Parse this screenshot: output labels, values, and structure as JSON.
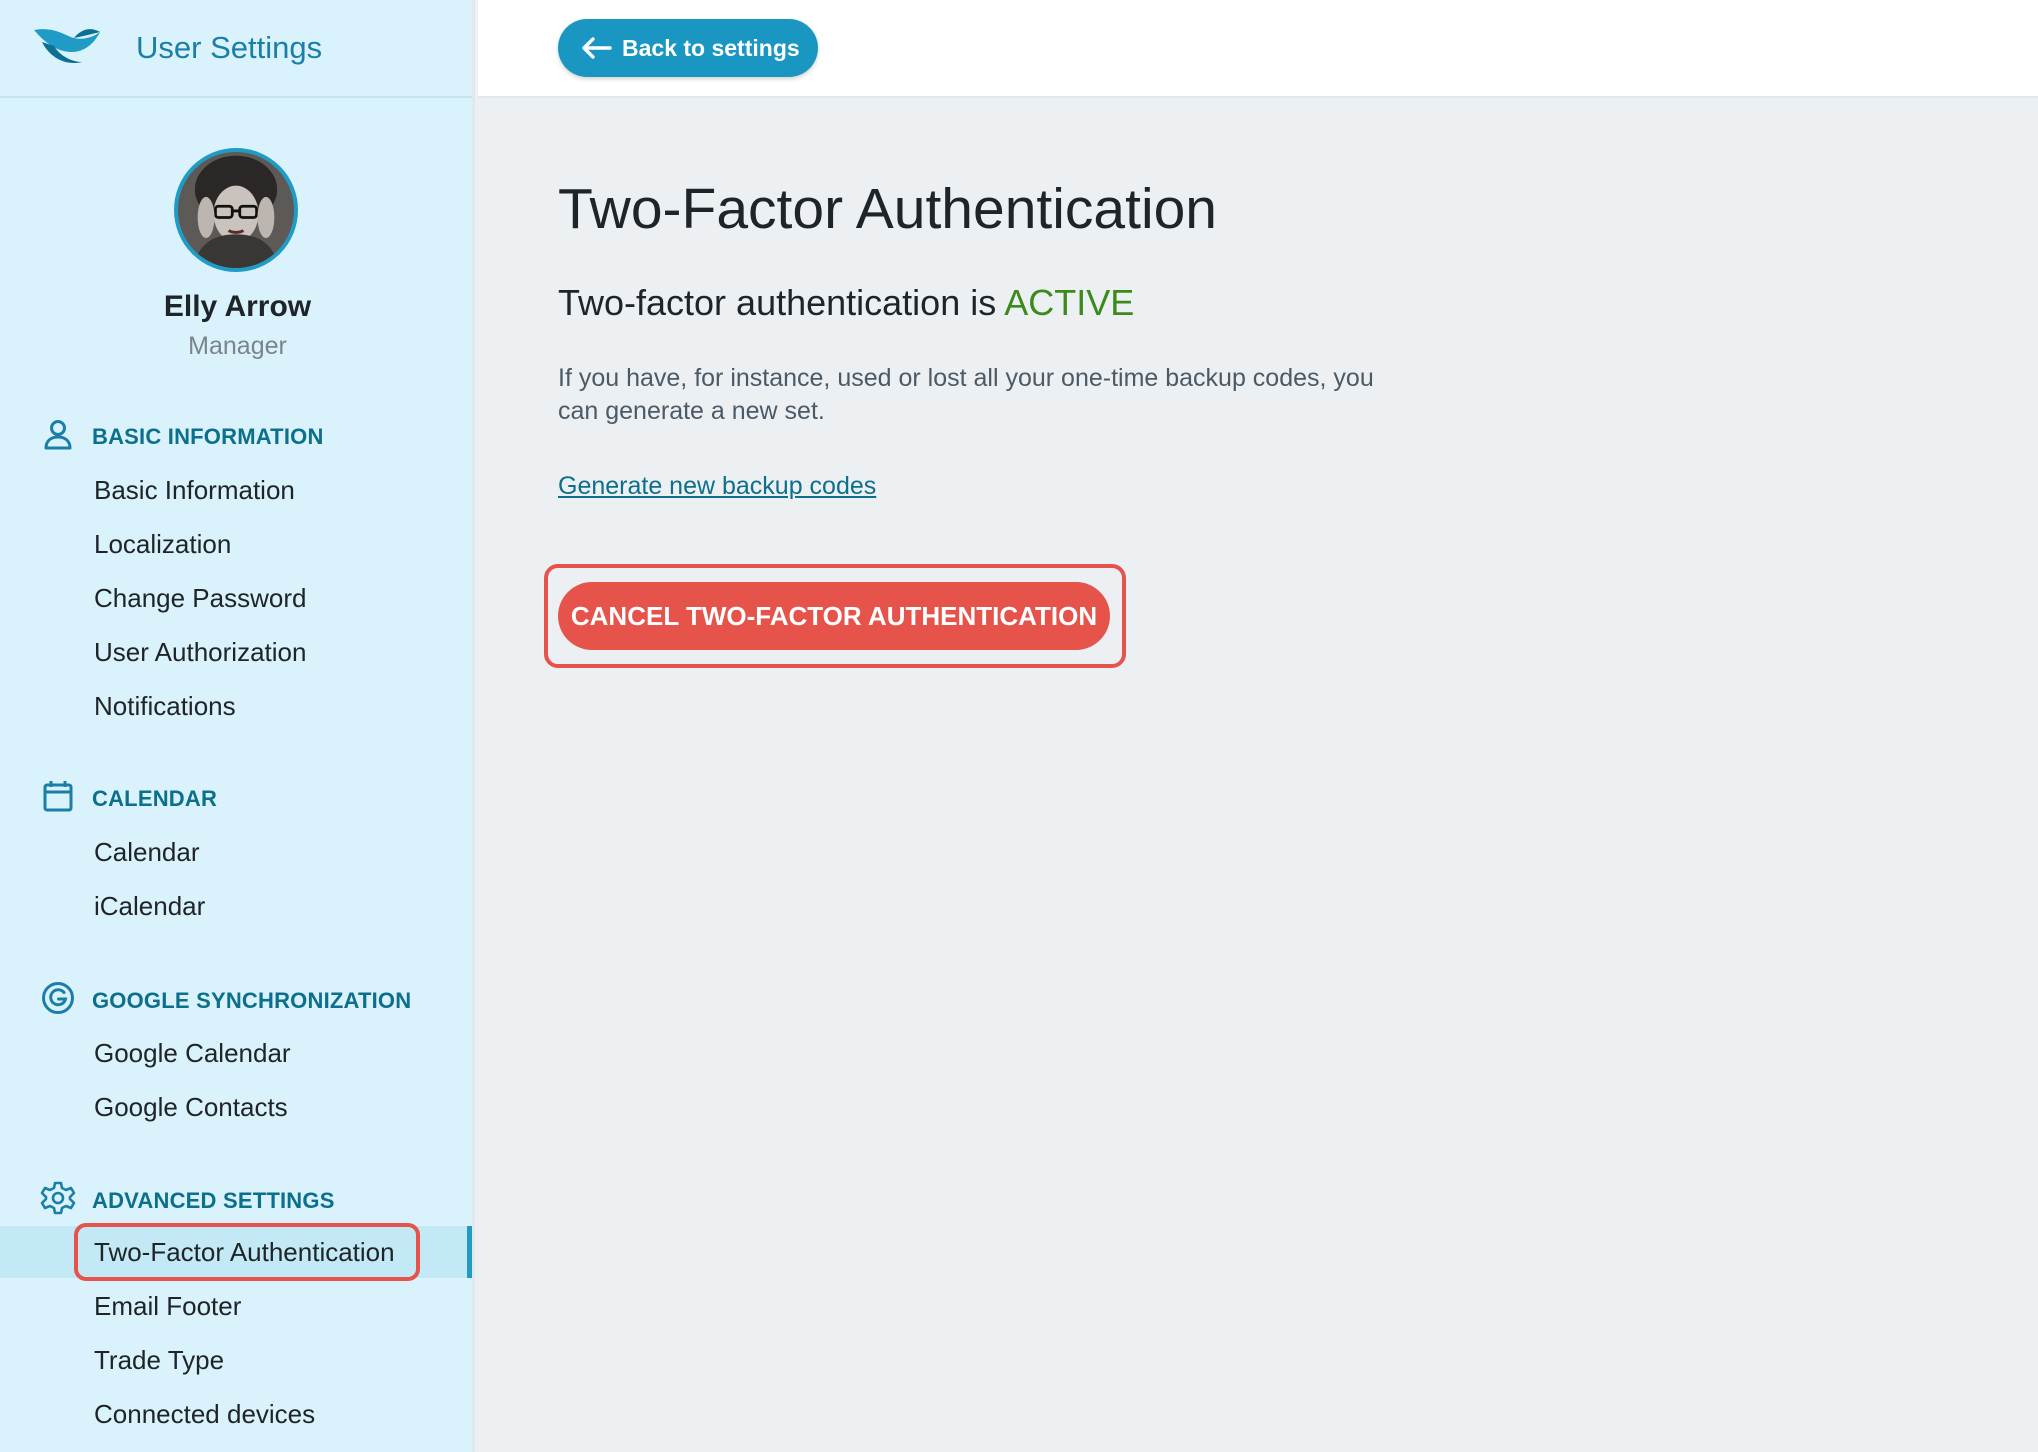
{
  "app": {
    "title": "User Settings",
    "logo_icon": "bird-logo-icon"
  },
  "user": {
    "name": "Elly Arrow",
    "role": "Manager"
  },
  "sidebar": {
    "sections": [
      {
        "heading": "BASIC INFORMATION",
        "icon": "person-icon",
        "items": [
          "Basic Information",
          "Localization",
          "Change Password",
          "User Authorization",
          "Notifications"
        ]
      },
      {
        "heading": "CALENDAR",
        "icon": "calendar-icon",
        "items": [
          "Calendar",
          "iCalendar"
        ]
      },
      {
        "heading": "GOOGLE SYNCHRONIZATION",
        "icon": "google-icon",
        "items": [
          "Google Calendar",
          "Google Contacts"
        ]
      },
      {
        "heading": "ADVANCED SETTINGS",
        "icon": "gear-icon",
        "items": [
          "Two-Factor Authentication",
          "Email Footer",
          "Trade Type",
          "Connected devices"
        ]
      }
    ],
    "active_item": "Two-Factor Authentication"
  },
  "topbar": {
    "back_label": "Back to settings",
    "back_icon": "arrow-left-icon"
  },
  "main": {
    "title": "Two-Factor Authentication",
    "status_prefix": "Two-factor authentication is ",
    "status_value": "ACTIVE",
    "description": "If you have, for instance, used or lost all your one-time backup codes, you can generate a new set.",
    "generate_link": "Generate new backup codes",
    "cancel_button": "CANCEL TWO-FACTOR AUTHENTICATION"
  },
  "colors": {
    "accent": "#1996c2",
    "sidebar_bg": "#d9f2fb",
    "section_heading": "#0c6f8c",
    "active_status": "#3b8a1b",
    "danger": "#e5534b",
    "main_bg": "#ecf0f3"
  }
}
